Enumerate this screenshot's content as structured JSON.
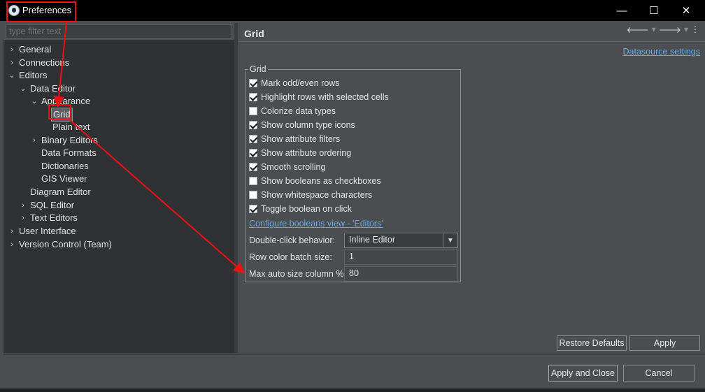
{
  "window": {
    "title": "Preferences",
    "controls": {
      "minimize": "—",
      "maximize": "☐",
      "close": "✕"
    }
  },
  "filter": {
    "placeholder": "type filter text"
  },
  "tree": {
    "general": "General",
    "connections": "Connections",
    "editors": "Editors",
    "data_editor": "Data Editor",
    "appearance": "Appearance",
    "grid": "Grid",
    "plain_text": "Plain text",
    "binary_editors": "Binary Editors",
    "data_formats": "Data Formats",
    "dictionaries": "Dictionaries",
    "gis_viewer": "GIS Viewer",
    "diagram_editor": "Diagram Editor",
    "sql_editor": "SQL Editor",
    "text_editors": "Text Editors",
    "user_interface": "User Interface",
    "version_control": "Version Control (Team)"
  },
  "page": {
    "title": "Grid",
    "datasource_link": "Datasource settings",
    "group_title": "Grid",
    "options": {
      "mark_odd_even": {
        "label": "Mark odd/even rows",
        "checked": true
      },
      "highlight_rows": {
        "label": "Highlight rows with selected cells",
        "checked": true
      },
      "colorize_types": {
        "label": "Colorize data types",
        "checked": false
      },
      "column_type_icons": {
        "label": "Show column type icons",
        "checked": true
      },
      "attribute_filters": {
        "label": "Show attribute filters",
        "checked": true
      },
      "attribute_ordering": {
        "label": "Show attribute ordering",
        "checked": true
      },
      "smooth_scrolling": {
        "label": "Smooth scrolling",
        "checked": true
      },
      "booleans_checkboxes": {
        "label": "Show booleans as checkboxes",
        "checked": false
      },
      "whitespace_chars": {
        "label": "Show whitespace characters",
        "checked": false
      },
      "toggle_boolean": {
        "label": "Toggle boolean on click",
        "checked": true
      }
    },
    "configure_link": "Configure booleans view  - 'Editors'",
    "double_click": {
      "label": "Double-click behavior:",
      "value": "Inline Editor"
    },
    "row_batch": {
      "label": "Row color batch size:",
      "value": "1"
    },
    "max_auto": {
      "label": "Max auto size column %:",
      "value": "80"
    }
  },
  "buttons": {
    "restore_defaults": "Restore Defaults",
    "apply": "Apply",
    "apply_and_close": "Apply and Close",
    "cancel": "Cancel"
  },
  "icons": {
    "back": "🡐",
    "forward": "🡒",
    "dropdown": "▾",
    "menu": "⋮",
    "chevron_right": "›",
    "chevron_down": "⌄"
  },
  "colors": {
    "annotation": "#e11111",
    "link": "#6aa7e8"
  }
}
